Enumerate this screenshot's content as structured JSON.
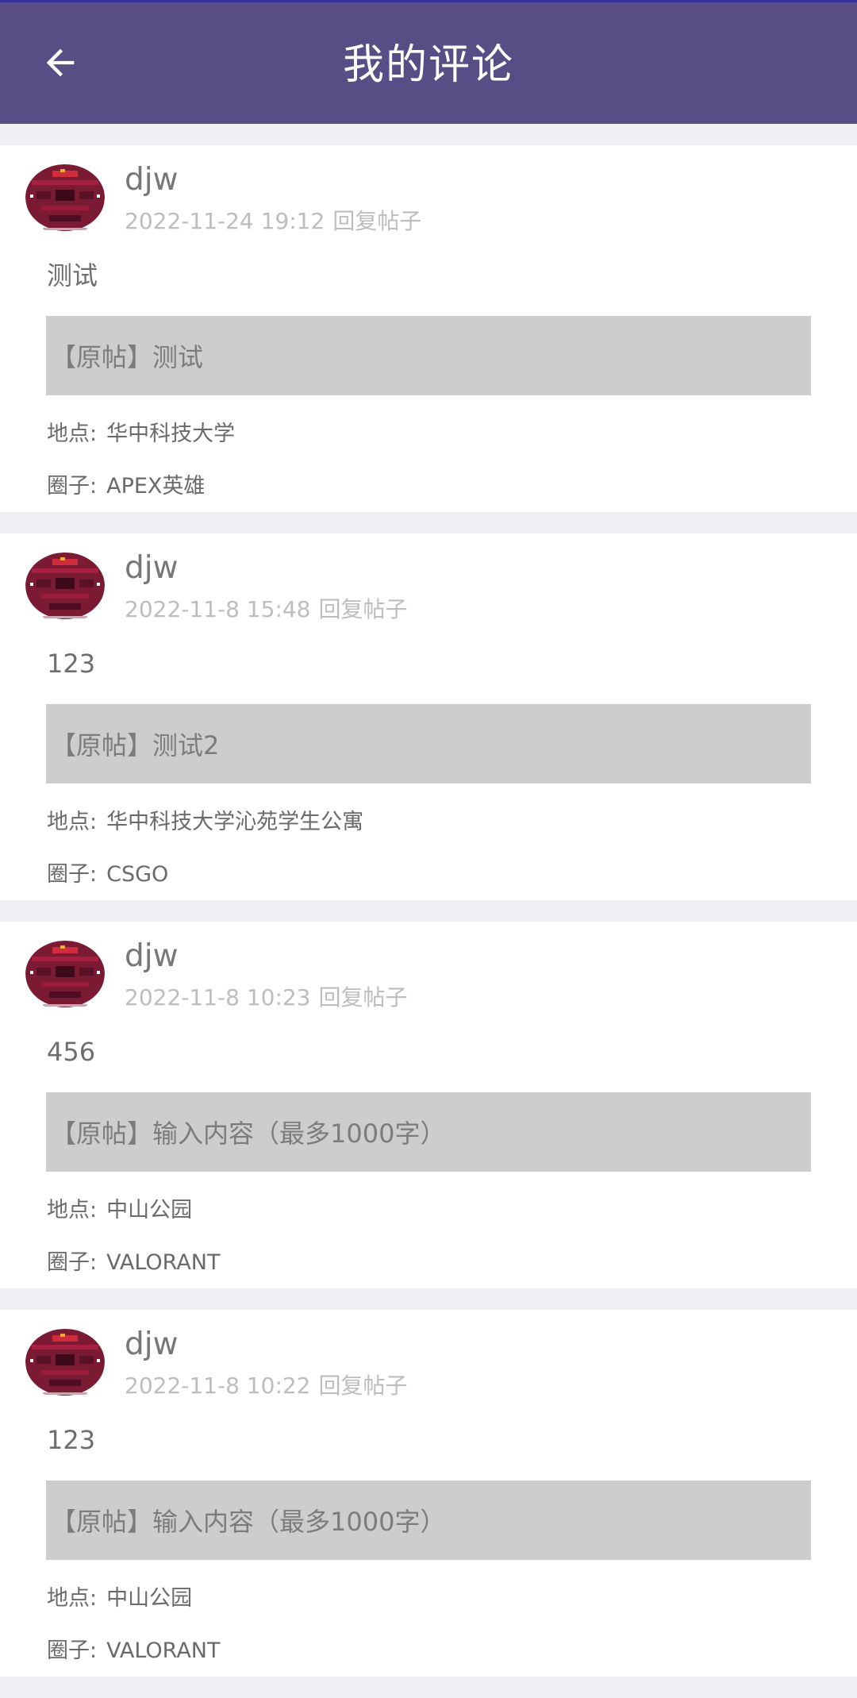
{
  "header": {
    "title": "我的评论",
    "back_icon": "arrow-left-icon"
  },
  "colors": {
    "app_bar": "#584e85",
    "card_bg": "#ffffff",
    "page_bg": "#eeeef3",
    "original_bg": "#cdcdcd"
  },
  "comments": [
    {
      "username": "djw",
      "time": "2022-11-24 19:12",
      "action": "回复帖子",
      "content": "测试",
      "original": "【原帖】测试",
      "location_label": "地点:",
      "location": "华中科技大学",
      "circle_label": "圈子:",
      "circle": "APEX英雄"
    },
    {
      "username": "djw",
      "time": "2022-11-8 15:48",
      "action": "回复帖子",
      "content": "123",
      "original": "【原帖】测试2",
      "location_label": "地点:",
      "location": "华中科技大学沁苑学生公寓",
      "circle_label": "圈子:",
      "circle": "CSGO"
    },
    {
      "username": "djw",
      "time": "2022-11-8 10:23",
      "action": "回复帖子",
      "content": "456",
      "original": "【原帖】输入内容（最多1000字）",
      "location_label": "地点:",
      "location": "中山公园",
      "circle_label": "圈子:",
      "circle": "VALORANT"
    },
    {
      "username": "djw",
      "time": "2022-11-8 10:22",
      "action": "回复帖子",
      "content": "123",
      "original": "【原帖】输入内容（最多1000字）",
      "location_label": "地点:",
      "location": "中山公园",
      "circle_label": "圈子:",
      "circle": "VALORANT"
    }
  ]
}
